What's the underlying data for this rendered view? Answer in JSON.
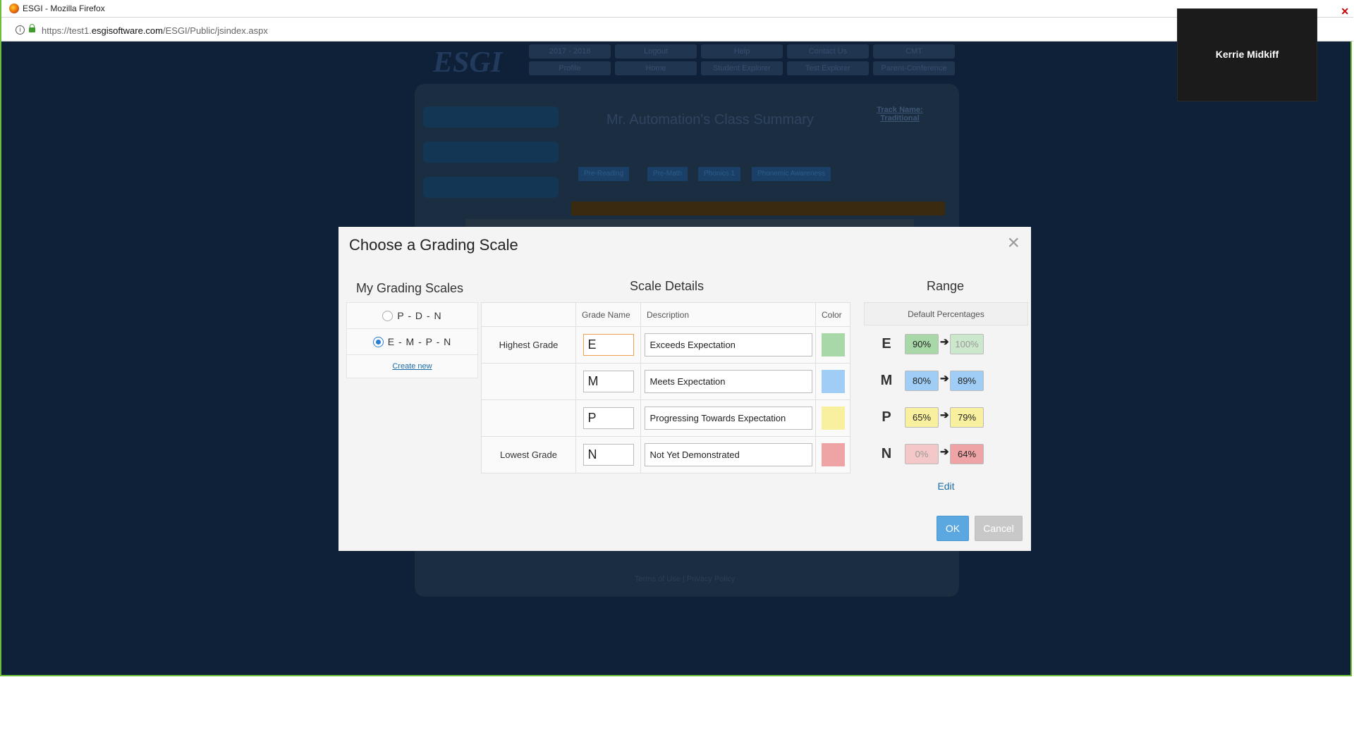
{
  "browser": {
    "window_title": "ESGI - Mozilla Firefox",
    "url_prefix": "https://test1.",
    "url_domain": "esgisoftware.com",
    "url_path": "/ESGI/Public/jsindex.aspx"
  },
  "webcam": {
    "name": "Kerrie Midkiff"
  },
  "background": {
    "logo": "ESGI",
    "nav_top": [
      "2017 - 2018",
      "Logout",
      "Help",
      "Contact Us",
      "CMT"
    ],
    "nav_bottom": [
      "Profile",
      "Home",
      "Student Explorer",
      "Test Explorer",
      "Parent-Conference"
    ],
    "title": "Mr. Automation's Class Summary",
    "track": "Track Name: Traditional",
    "tabs": [
      "Pre-Reading",
      "Pre-Math",
      "Phonics 1",
      "Phonemic Awareness"
    ],
    "footer": "Terms of Use  |  Privacy Policy"
  },
  "modal": {
    "title": "Choose a Grading Scale",
    "close": "×",
    "scales_heading": "My Grading Scales",
    "details_heading": "Scale Details",
    "range_heading": "Range",
    "scales": [
      {
        "label": "P - D - N",
        "selected": false
      },
      {
        "label": "E - M - P - N",
        "selected": true
      }
    ],
    "create_new": "Create new",
    "columns": {
      "grade_name": "Grade Name",
      "description": "Description",
      "color": "Color"
    },
    "range_header": "Default Percentages",
    "grades": [
      {
        "row_label": "Highest Grade",
        "name": "E",
        "description": "Exceeds Expectation",
        "color": "#a8d8a8",
        "low": "90%",
        "high": "100%"
      },
      {
        "row_label": "",
        "name": "M",
        "description": "Meets Expectation",
        "color": "#9fcdf5",
        "low": "80%",
        "high": "89%"
      },
      {
        "row_label": "",
        "name": "P",
        "description": "Progressing Towards Expectation",
        "color": "#f8ef9f",
        "low": "65%",
        "high": "79%"
      },
      {
        "row_label": "Lowest Grade",
        "name": "N",
        "description": "Not Yet Demonstrated",
        "color": "#eea4a4",
        "low": "0%",
        "high": "64%"
      }
    ],
    "edit": "Edit",
    "ok": "OK",
    "cancel": "Cancel"
  }
}
